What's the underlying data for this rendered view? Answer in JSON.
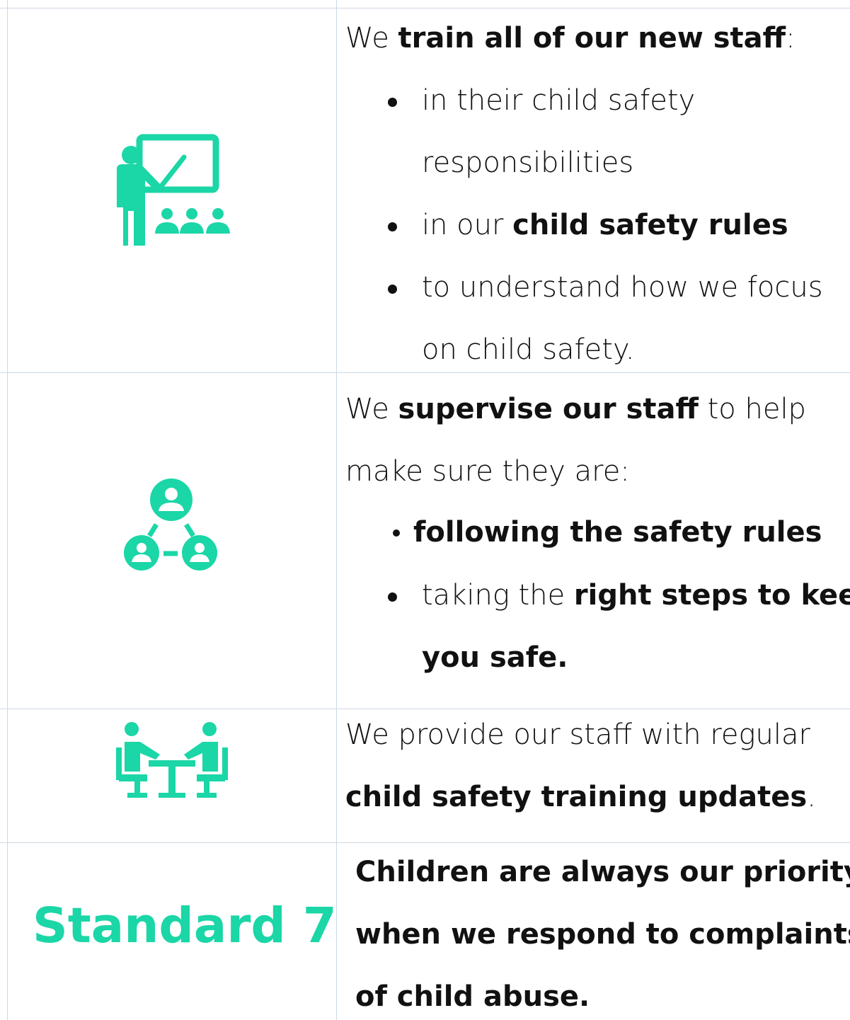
{
  "rows": [
    {
      "icon": "teacher-presentation-icon",
      "intro": {
        "pre": "We ",
        "bold": "train all of our new staff",
        "post": ":"
      },
      "bullets": [
        {
          "line1": "in their child safety",
          "line2": "responsibilities"
        },
        {
          "pre": "in our ",
          "bold": "child safety rules"
        },
        {
          "line1": "to understand how we focus",
          "line2": "on child safety."
        }
      ]
    },
    {
      "icon": "supervision-network-icon",
      "intro": {
        "pre": "We ",
        "bold": "supervise our staff",
        "post": " to help",
        "line2": "make sure they are:"
      },
      "bullets": [
        {
          "bold": "following the safety rules"
        },
        {
          "pre": "taking the ",
          "bold": "right steps to keep",
          "bold2": "you safe."
        }
      ]
    },
    {
      "icon": "training-meeting-icon",
      "line1": "We provide our staff with regular",
      "bold": "child safety training updates",
      "post": "."
    },
    {
      "label": "Standard 7",
      "lines": [
        "Children are always our priority",
        "when we respond to complaints",
        "of child abuse."
      ]
    }
  ],
  "colors": {
    "accent": "#1bd6a6",
    "grid": "#cdd9e3",
    "text": "#111111"
  }
}
